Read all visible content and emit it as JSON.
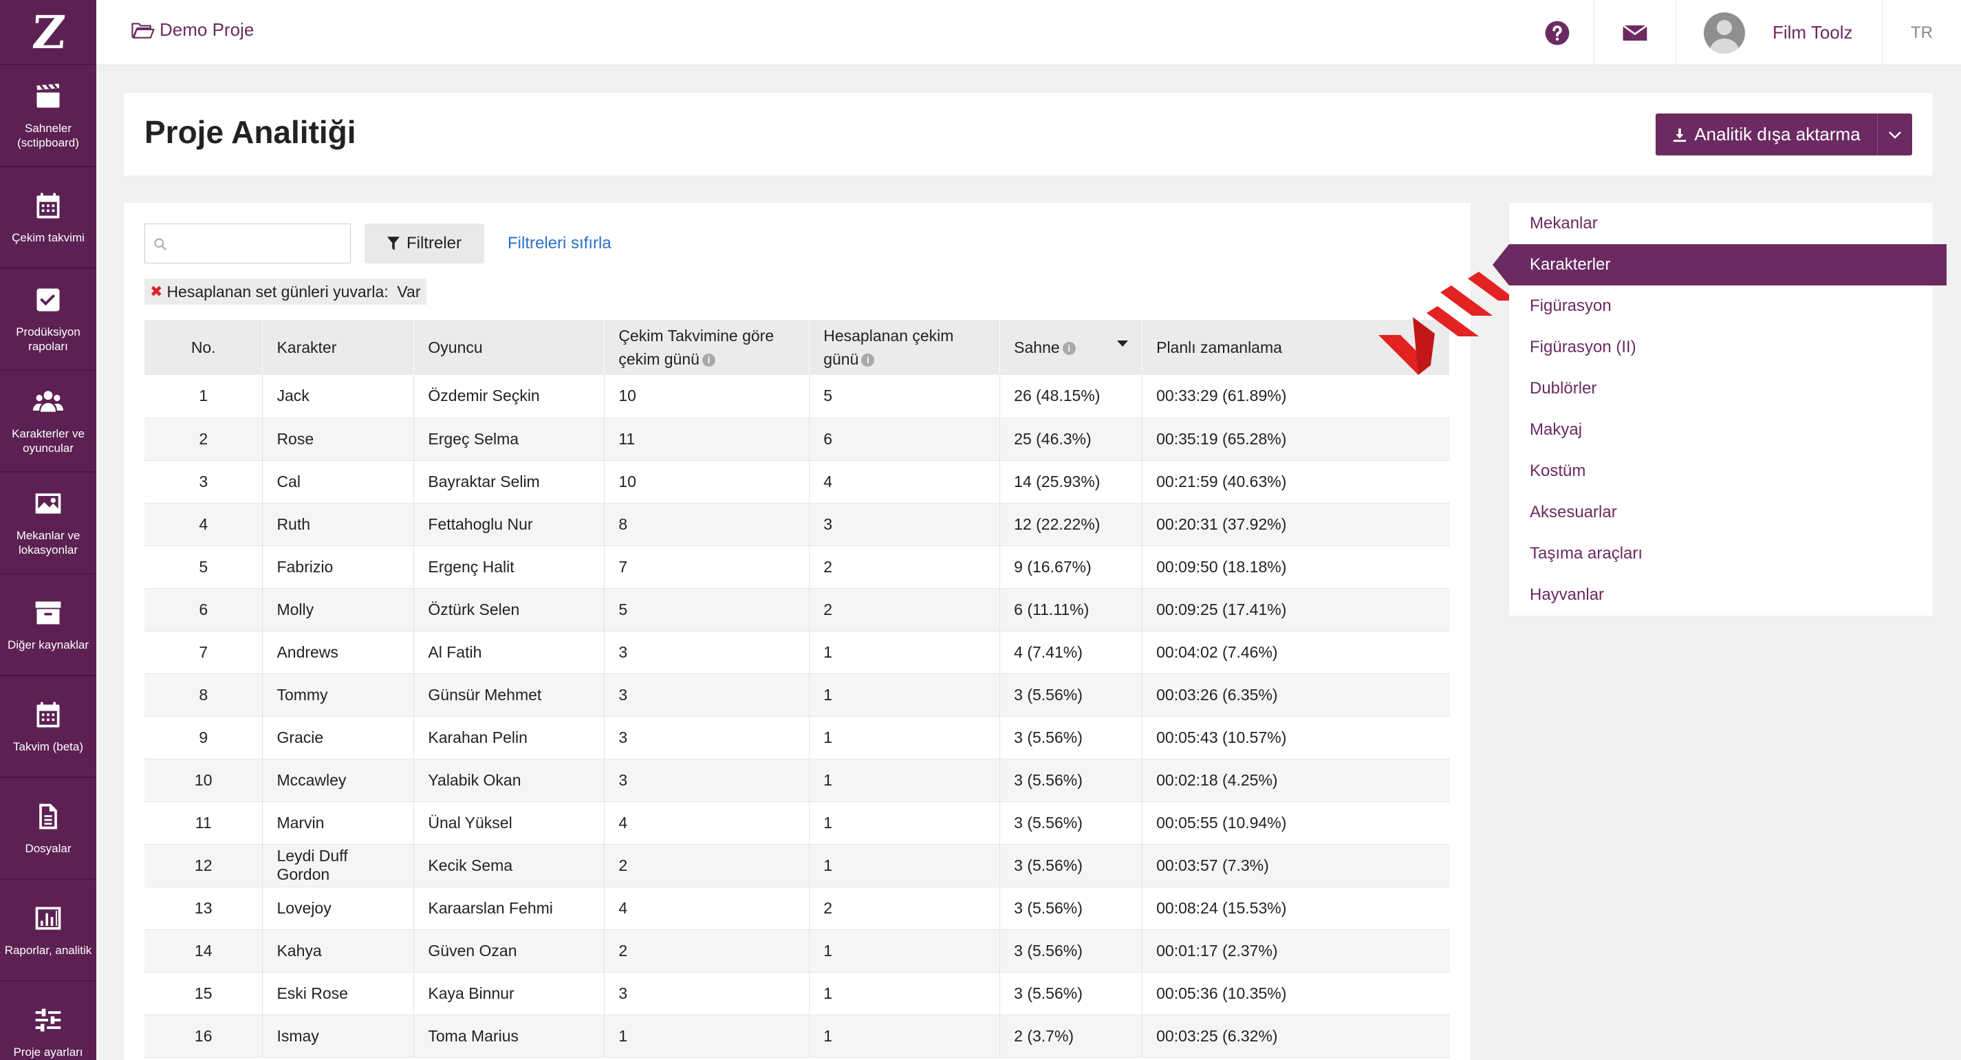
{
  "app": {
    "logo_letter": "Z"
  },
  "sidebar": {
    "items": [
      {
        "label": "Sahneler (sctipboard)"
      },
      {
        "label": "Çekim takvimi"
      },
      {
        "label": "Prodüksiyon rapoları"
      },
      {
        "label": "Karakterler ve oyuncular"
      },
      {
        "label": "Mekanlar ve lokasyonlar"
      },
      {
        "label": "Diğer kaynaklar"
      },
      {
        "label": "Takvim (beta)"
      },
      {
        "label": "Dosyalar"
      },
      {
        "label": "Raporlar, analitik"
      },
      {
        "label": "Proje ayarları"
      }
    ]
  },
  "header": {
    "breadcrumb": "Demo Proje",
    "user_name": "Film Toolz",
    "language": "TR"
  },
  "page": {
    "title": "Proje Analitiği",
    "export_label": "Analitik dışa aktarma"
  },
  "toolbar": {
    "search_placeholder": "",
    "filter_label": "Filtreler",
    "reset_label": "Filtreleri sıfırla",
    "chip_text": "Hesaplanan set günleri yuvarla:  Var"
  },
  "table": {
    "headers": {
      "no": "No.",
      "character": "Karakter",
      "actor": "Oyuncu",
      "schedule_days_1": "Çekim Takvimine göre",
      "schedule_days_2": "çekim günü",
      "calc_days_1": "Hesaplanan çekim",
      "calc_days_2": "günü",
      "scenes": "Sahne",
      "planned": "Planlı zamanlama"
    },
    "rows": [
      [
        "1",
        "Jack",
        "Özdemir Seçkin",
        "10",
        "5",
        "26 (48.15%)",
        "00:33:29 (61.89%)"
      ],
      [
        "2",
        "Rose",
        "Ergeç Selma",
        "11",
        "6",
        "25 (46.3%)",
        "00:35:19 (65.28%)"
      ],
      [
        "3",
        "Cal",
        "Bayraktar Selim",
        "10",
        "4",
        "14 (25.93%)",
        "00:21:59 (40.63%)"
      ],
      [
        "4",
        "Ruth",
        "Fettahoglu Nur",
        "8",
        "3",
        "12 (22.22%)",
        "00:20:31 (37.92%)"
      ],
      [
        "5",
        "Fabrizio",
        "Ergenç Halit",
        "7",
        "2",
        "9 (16.67%)",
        "00:09:50 (18.18%)"
      ],
      [
        "6",
        "Molly",
        "Öztürk Selen",
        "5",
        "2",
        "6 (11.11%)",
        "00:09:25 (17.41%)"
      ],
      [
        "7",
        "Andrews",
        "Al Fatih",
        "3",
        "1",
        "4 (7.41%)",
        "00:04:02 (7.46%)"
      ],
      [
        "8",
        "Tommy",
        "Günsür Mehmet",
        "3",
        "1",
        "3 (5.56%)",
        "00:03:26 (6.35%)"
      ],
      [
        "9",
        "Gracie",
        "Karahan Pelin",
        "3",
        "1",
        "3 (5.56%)",
        "00:05:43 (10.57%)"
      ],
      [
        "10",
        "Mccawley",
        "Yalabik Okan",
        "3",
        "1",
        "3 (5.56%)",
        "00:02:18 (4.25%)"
      ],
      [
        "11",
        "Marvin",
        "Ünal Yüksel",
        "4",
        "1",
        "3 (5.56%)",
        "00:05:55 (10.94%)"
      ],
      [
        "12",
        "Leydi Duff Gordon",
        "Kecik Sema",
        "2",
        "1",
        "3 (5.56%)",
        "00:03:57 (7.3%)"
      ],
      [
        "13",
        "Lovejoy",
        "Karaarslan Fehmi",
        "4",
        "2",
        "3 (5.56%)",
        "00:08:24 (15.53%)"
      ],
      [
        "14",
        "Kahya",
        "Güven Ozan",
        "2",
        "1",
        "3 (5.56%)",
        "00:01:17 (2.37%)"
      ],
      [
        "15",
        "Eski Rose",
        "Kaya Binnur",
        "3",
        "1",
        "3 (5.56%)",
        "00:05:36 (10.35%)"
      ],
      [
        "16",
        "Ismay",
        "Toma Marius",
        "1",
        "1",
        "2 (3.7%)",
        "00:03:25 (6.32%)"
      ]
    ]
  },
  "right_nav": {
    "items": [
      {
        "label": "Mekanlar",
        "active": false
      },
      {
        "label": "Karakterler",
        "active": true
      },
      {
        "label": "Figürasyon",
        "active": false
      },
      {
        "label": "Figürasyon (II)",
        "active": false
      },
      {
        "label": "Dublörler",
        "active": false
      },
      {
        "label": "Makyaj",
        "active": false
      },
      {
        "label": "Kostüm",
        "active": false
      },
      {
        "label": "Aksesuarlar",
        "active": false
      },
      {
        "label": "Taşıma araçları",
        "active": false
      },
      {
        "label": "Hayvanlar",
        "active": false
      }
    ]
  },
  "colors": {
    "brand": "#6b2a61",
    "sidebar": "#5c2152",
    "link": "#2a6fc9",
    "arrow": "#e32222"
  }
}
